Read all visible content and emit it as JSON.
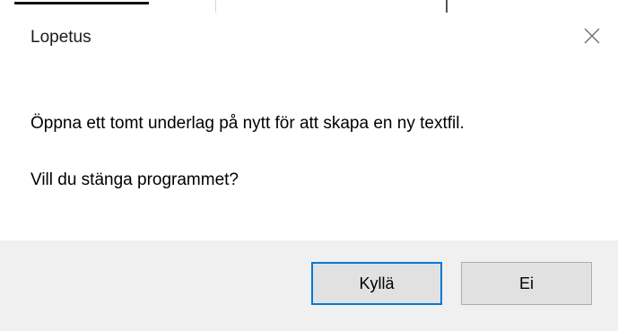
{
  "dialog": {
    "title": "Lopetus",
    "message": "Öppna ett tomt underlag på nytt för att skapa en ny textfil.",
    "question": "Vill du stänga programmet?",
    "buttons": {
      "yes_label": "Kyllä",
      "no_label": "Ei"
    },
    "close_icon": "close-icon",
    "accent_color": "#0078d7",
    "footer_color": "#f0f0f0"
  }
}
